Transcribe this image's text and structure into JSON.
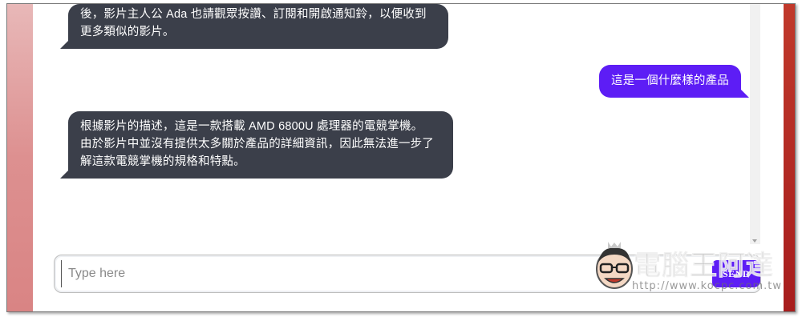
{
  "chat": {
    "messages": [
      {
        "role": "bot",
        "lines": [
          "後，影片主人公 Ada 也請觀眾按讚、訂閱和開啟通知鈴，以便收到",
          "更多類似的影片。"
        ]
      },
      {
        "role": "user",
        "lines": [
          "這是一個什麼樣的產品"
        ]
      },
      {
        "role": "bot",
        "lines": [
          "根據影片的描述，這是一款搭載 AMD 6800U 處理器的電競掌機。",
          "由於影片中並沒有提供太多關於產品的詳細資訊，因此無法進一步了",
          "解這款電競掌機的規格和特點。"
        ]
      }
    ]
  },
  "composer": {
    "placeholder": "Type here",
    "send_label": "SEND"
  },
  "watermark": {
    "title": "電腦王阿達",
    "url": "http://www.kocpc.com.tw"
  },
  "colors": {
    "bot_bubble": "#3b3f4a",
    "user_bubble": "#5d1df5",
    "send_button": "#5d1df5"
  }
}
